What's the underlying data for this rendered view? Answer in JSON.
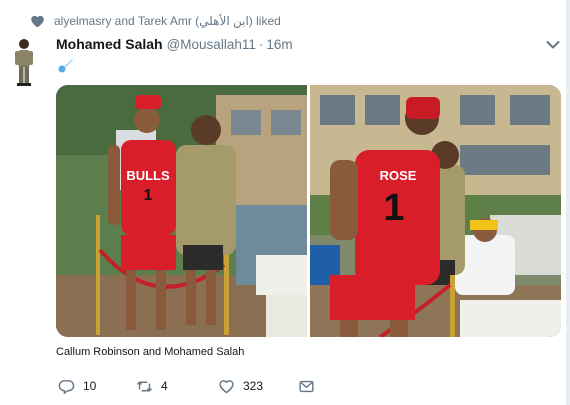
{
  "liked": {
    "text": "alyelmasry and Tarek Amr (ابن الأهلي) liked",
    "icon": "heart-icon"
  },
  "tweet": {
    "author_name": "Mohamed Salah",
    "handle": "@Mousallah11",
    "separator": "·",
    "timestamp": "16m",
    "emoji_icon": "comet-icon",
    "menu_icon": "chevron-down-icon",
    "caption": "Callum Robinson and Mohamed Salah"
  },
  "actions": {
    "reply_count": "10",
    "retweet_count": "4",
    "like_count": "323"
  },
  "photo_text": {
    "left_jersey": "BULLS",
    "left_number": "1",
    "right_jersey": "ROSE",
    "right_number": "1"
  },
  "colors": {
    "secondary_text": "#657786",
    "accent": "#1da1f2",
    "jersey_red": "#d91e2a"
  }
}
